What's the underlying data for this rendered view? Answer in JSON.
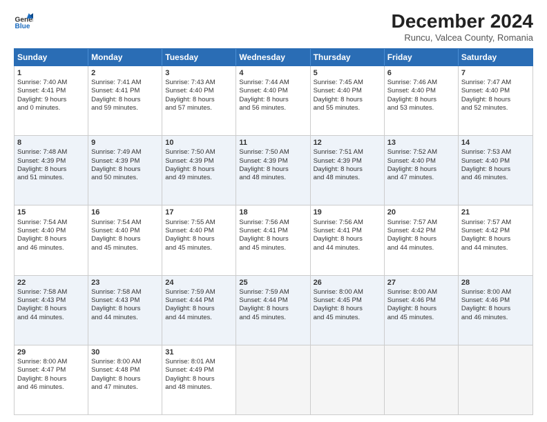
{
  "logo": {
    "line1": "General",
    "line2": "Blue"
  },
  "title": "December 2024",
  "subtitle": "Runcu, Valcea County, Romania",
  "header_days": [
    "Sunday",
    "Monday",
    "Tuesday",
    "Wednesday",
    "Thursday",
    "Friday",
    "Saturday"
  ],
  "rows": [
    [
      {
        "day": "1",
        "lines": [
          "Sunrise: 7:40 AM",
          "Sunset: 4:41 PM",
          "Daylight: 9 hours",
          "and 0 minutes."
        ]
      },
      {
        "day": "2",
        "lines": [
          "Sunrise: 7:41 AM",
          "Sunset: 4:41 PM",
          "Daylight: 8 hours",
          "and 59 minutes."
        ]
      },
      {
        "day": "3",
        "lines": [
          "Sunrise: 7:43 AM",
          "Sunset: 4:40 PM",
          "Daylight: 8 hours",
          "and 57 minutes."
        ]
      },
      {
        "day": "4",
        "lines": [
          "Sunrise: 7:44 AM",
          "Sunset: 4:40 PM",
          "Daylight: 8 hours",
          "and 56 minutes."
        ]
      },
      {
        "day": "5",
        "lines": [
          "Sunrise: 7:45 AM",
          "Sunset: 4:40 PM",
          "Daylight: 8 hours",
          "and 55 minutes."
        ]
      },
      {
        "day": "6",
        "lines": [
          "Sunrise: 7:46 AM",
          "Sunset: 4:40 PM",
          "Daylight: 8 hours",
          "and 53 minutes."
        ]
      },
      {
        "day": "7",
        "lines": [
          "Sunrise: 7:47 AM",
          "Sunset: 4:40 PM",
          "Daylight: 8 hours",
          "and 52 minutes."
        ]
      }
    ],
    [
      {
        "day": "8",
        "lines": [
          "Sunrise: 7:48 AM",
          "Sunset: 4:39 PM",
          "Daylight: 8 hours",
          "and 51 minutes."
        ]
      },
      {
        "day": "9",
        "lines": [
          "Sunrise: 7:49 AM",
          "Sunset: 4:39 PM",
          "Daylight: 8 hours",
          "and 50 minutes."
        ]
      },
      {
        "day": "10",
        "lines": [
          "Sunrise: 7:50 AM",
          "Sunset: 4:39 PM",
          "Daylight: 8 hours",
          "and 49 minutes."
        ]
      },
      {
        "day": "11",
        "lines": [
          "Sunrise: 7:50 AM",
          "Sunset: 4:39 PM",
          "Daylight: 8 hours",
          "and 48 minutes."
        ]
      },
      {
        "day": "12",
        "lines": [
          "Sunrise: 7:51 AM",
          "Sunset: 4:39 PM",
          "Daylight: 8 hours",
          "and 48 minutes."
        ]
      },
      {
        "day": "13",
        "lines": [
          "Sunrise: 7:52 AM",
          "Sunset: 4:40 PM",
          "Daylight: 8 hours",
          "and 47 minutes."
        ]
      },
      {
        "day": "14",
        "lines": [
          "Sunrise: 7:53 AM",
          "Sunset: 4:40 PM",
          "Daylight: 8 hours",
          "and 46 minutes."
        ]
      }
    ],
    [
      {
        "day": "15",
        "lines": [
          "Sunrise: 7:54 AM",
          "Sunset: 4:40 PM",
          "Daylight: 8 hours",
          "and 46 minutes."
        ]
      },
      {
        "day": "16",
        "lines": [
          "Sunrise: 7:54 AM",
          "Sunset: 4:40 PM",
          "Daylight: 8 hours",
          "and 45 minutes."
        ]
      },
      {
        "day": "17",
        "lines": [
          "Sunrise: 7:55 AM",
          "Sunset: 4:40 PM",
          "Daylight: 8 hours",
          "and 45 minutes."
        ]
      },
      {
        "day": "18",
        "lines": [
          "Sunrise: 7:56 AM",
          "Sunset: 4:41 PM",
          "Daylight: 8 hours",
          "and 45 minutes."
        ]
      },
      {
        "day": "19",
        "lines": [
          "Sunrise: 7:56 AM",
          "Sunset: 4:41 PM",
          "Daylight: 8 hours",
          "and 44 minutes."
        ]
      },
      {
        "day": "20",
        "lines": [
          "Sunrise: 7:57 AM",
          "Sunset: 4:42 PM",
          "Daylight: 8 hours",
          "and 44 minutes."
        ]
      },
      {
        "day": "21",
        "lines": [
          "Sunrise: 7:57 AM",
          "Sunset: 4:42 PM",
          "Daylight: 8 hours",
          "and 44 minutes."
        ]
      }
    ],
    [
      {
        "day": "22",
        "lines": [
          "Sunrise: 7:58 AM",
          "Sunset: 4:43 PM",
          "Daylight: 8 hours",
          "and 44 minutes."
        ]
      },
      {
        "day": "23",
        "lines": [
          "Sunrise: 7:58 AM",
          "Sunset: 4:43 PM",
          "Daylight: 8 hours",
          "and 44 minutes."
        ]
      },
      {
        "day": "24",
        "lines": [
          "Sunrise: 7:59 AM",
          "Sunset: 4:44 PM",
          "Daylight: 8 hours",
          "and 44 minutes."
        ]
      },
      {
        "day": "25",
        "lines": [
          "Sunrise: 7:59 AM",
          "Sunset: 4:44 PM",
          "Daylight: 8 hours",
          "and 45 minutes."
        ]
      },
      {
        "day": "26",
        "lines": [
          "Sunrise: 8:00 AM",
          "Sunset: 4:45 PM",
          "Daylight: 8 hours",
          "and 45 minutes."
        ]
      },
      {
        "day": "27",
        "lines": [
          "Sunrise: 8:00 AM",
          "Sunset: 4:46 PM",
          "Daylight: 8 hours",
          "and 45 minutes."
        ]
      },
      {
        "day": "28",
        "lines": [
          "Sunrise: 8:00 AM",
          "Sunset: 4:46 PM",
          "Daylight: 8 hours",
          "and 46 minutes."
        ]
      }
    ],
    [
      {
        "day": "29",
        "lines": [
          "Sunrise: 8:00 AM",
          "Sunset: 4:47 PM",
          "Daylight: 8 hours",
          "and 46 minutes."
        ]
      },
      {
        "day": "30",
        "lines": [
          "Sunrise: 8:00 AM",
          "Sunset: 4:48 PM",
          "Daylight: 8 hours",
          "and 47 minutes."
        ]
      },
      {
        "day": "31",
        "lines": [
          "Sunrise: 8:01 AM",
          "Sunset: 4:49 PM",
          "Daylight: 8 hours",
          "and 48 minutes."
        ]
      },
      null,
      null,
      null,
      null
    ]
  ],
  "row_styles": [
    "light",
    "alt",
    "light",
    "alt",
    "light"
  ]
}
